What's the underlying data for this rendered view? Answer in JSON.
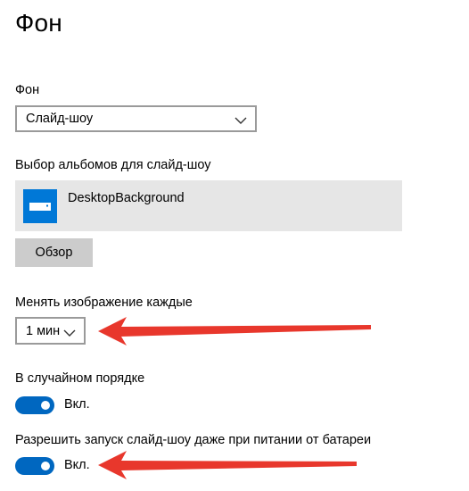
{
  "page": {
    "title": "Фон"
  },
  "background": {
    "label": "Фон",
    "selected": "Слайд-шоу"
  },
  "albums": {
    "label": "Выбор альбомов для слайд-шоу",
    "items": [
      {
        "name": "DesktopBackground",
        "icon": "folder-icon"
      }
    ],
    "browse_label": "Обзор"
  },
  "interval": {
    "label": "Менять изображение каждые",
    "selected": "1 мин"
  },
  "shuffle": {
    "label": "В случайном порядке",
    "state": "Вкл.",
    "on": true
  },
  "battery": {
    "label": "Разрешить запуск слайд-шоу даже при питании от батареи",
    "state": "Вкл.",
    "on": true
  },
  "colors": {
    "accent": "#0078d7",
    "toggle": "#0067c0",
    "annotation_arrow": "#e8372c"
  }
}
